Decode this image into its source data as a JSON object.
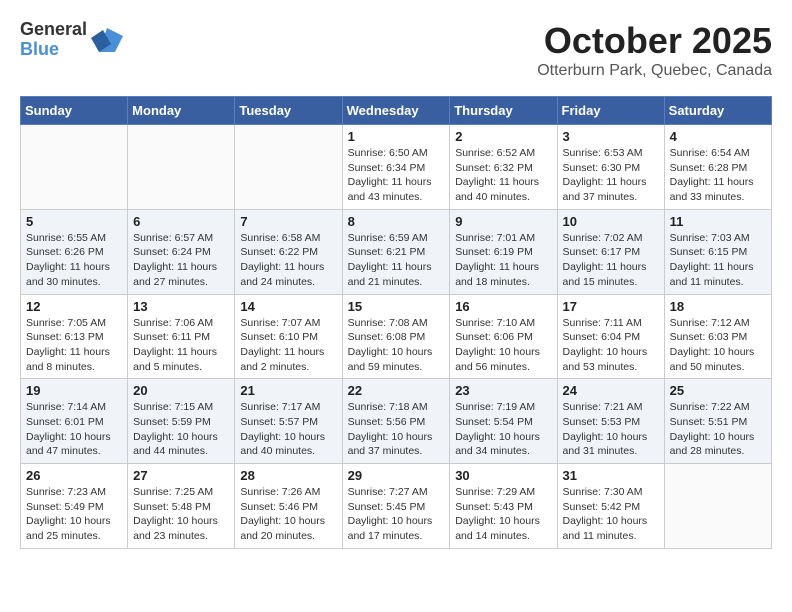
{
  "header": {
    "logo_general": "General",
    "logo_blue": "Blue",
    "month_title": "October 2025",
    "location": "Otterburn Park, Quebec, Canada"
  },
  "weekdays": [
    "Sunday",
    "Monday",
    "Tuesday",
    "Wednesday",
    "Thursday",
    "Friday",
    "Saturday"
  ],
  "weeks": [
    [
      {
        "day": "",
        "info": ""
      },
      {
        "day": "",
        "info": ""
      },
      {
        "day": "",
        "info": ""
      },
      {
        "day": "1",
        "info": "Sunrise: 6:50 AM\nSunset: 6:34 PM\nDaylight: 11 hours\nand 43 minutes."
      },
      {
        "day": "2",
        "info": "Sunrise: 6:52 AM\nSunset: 6:32 PM\nDaylight: 11 hours\nand 40 minutes."
      },
      {
        "day": "3",
        "info": "Sunrise: 6:53 AM\nSunset: 6:30 PM\nDaylight: 11 hours\nand 37 minutes."
      },
      {
        "day": "4",
        "info": "Sunrise: 6:54 AM\nSunset: 6:28 PM\nDaylight: 11 hours\nand 33 minutes."
      }
    ],
    [
      {
        "day": "5",
        "info": "Sunrise: 6:55 AM\nSunset: 6:26 PM\nDaylight: 11 hours\nand 30 minutes."
      },
      {
        "day": "6",
        "info": "Sunrise: 6:57 AM\nSunset: 6:24 PM\nDaylight: 11 hours\nand 27 minutes."
      },
      {
        "day": "7",
        "info": "Sunrise: 6:58 AM\nSunset: 6:22 PM\nDaylight: 11 hours\nand 24 minutes."
      },
      {
        "day": "8",
        "info": "Sunrise: 6:59 AM\nSunset: 6:21 PM\nDaylight: 11 hours\nand 21 minutes."
      },
      {
        "day": "9",
        "info": "Sunrise: 7:01 AM\nSunset: 6:19 PM\nDaylight: 11 hours\nand 18 minutes."
      },
      {
        "day": "10",
        "info": "Sunrise: 7:02 AM\nSunset: 6:17 PM\nDaylight: 11 hours\nand 15 minutes."
      },
      {
        "day": "11",
        "info": "Sunrise: 7:03 AM\nSunset: 6:15 PM\nDaylight: 11 hours\nand 11 minutes."
      }
    ],
    [
      {
        "day": "12",
        "info": "Sunrise: 7:05 AM\nSunset: 6:13 PM\nDaylight: 11 hours\nand 8 minutes."
      },
      {
        "day": "13",
        "info": "Sunrise: 7:06 AM\nSunset: 6:11 PM\nDaylight: 11 hours\nand 5 minutes."
      },
      {
        "day": "14",
        "info": "Sunrise: 7:07 AM\nSunset: 6:10 PM\nDaylight: 11 hours\nand 2 minutes."
      },
      {
        "day": "15",
        "info": "Sunrise: 7:08 AM\nSunset: 6:08 PM\nDaylight: 10 hours\nand 59 minutes."
      },
      {
        "day": "16",
        "info": "Sunrise: 7:10 AM\nSunset: 6:06 PM\nDaylight: 10 hours\nand 56 minutes."
      },
      {
        "day": "17",
        "info": "Sunrise: 7:11 AM\nSunset: 6:04 PM\nDaylight: 10 hours\nand 53 minutes."
      },
      {
        "day": "18",
        "info": "Sunrise: 7:12 AM\nSunset: 6:03 PM\nDaylight: 10 hours\nand 50 minutes."
      }
    ],
    [
      {
        "day": "19",
        "info": "Sunrise: 7:14 AM\nSunset: 6:01 PM\nDaylight: 10 hours\nand 47 minutes."
      },
      {
        "day": "20",
        "info": "Sunrise: 7:15 AM\nSunset: 5:59 PM\nDaylight: 10 hours\nand 44 minutes."
      },
      {
        "day": "21",
        "info": "Sunrise: 7:17 AM\nSunset: 5:57 PM\nDaylight: 10 hours\nand 40 minutes."
      },
      {
        "day": "22",
        "info": "Sunrise: 7:18 AM\nSunset: 5:56 PM\nDaylight: 10 hours\nand 37 minutes."
      },
      {
        "day": "23",
        "info": "Sunrise: 7:19 AM\nSunset: 5:54 PM\nDaylight: 10 hours\nand 34 minutes."
      },
      {
        "day": "24",
        "info": "Sunrise: 7:21 AM\nSunset: 5:53 PM\nDaylight: 10 hours\nand 31 minutes."
      },
      {
        "day": "25",
        "info": "Sunrise: 7:22 AM\nSunset: 5:51 PM\nDaylight: 10 hours\nand 28 minutes."
      }
    ],
    [
      {
        "day": "26",
        "info": "Sunrise: 7:23 AM\nSunset: 5:49 PM\nDaylight: 10 hours\nand 25 minutes."
      },
      {
        "day": "27",
        "info": "Sunrise: 7:25 AM\nSunset: 5:48 PM\nDaylight: 10 hours\nand 23 minutes."
      },
      {
        "day": "28",
        "info": "Sunrise: 7:26 AM\nSunset: 5:46 PM\nDaylight: 10 hours\nand 20 minutes."
      },
      {
        "day": "29",
        "info": "Sunrise: 7:27 AM\nSunset: 5:45 PM\nDaylight: 10 hours\nand 17 minutes."
      },
      {
        "day": "30",
        "info": "Sunrise: 7:29 AM\nSunset: 5:43 PM\nDaylight: 10 hours\nand 14 minutes."
      },
      {
        "day": "31",
        "info": "Sunrise: 7:30 AM\nSunset: 5:42 PM\nDaylight: 10 hours\nand 11 minutes."
      },
      {
        "day": "",
        "info": ""
      }
    ]
  ]
}
